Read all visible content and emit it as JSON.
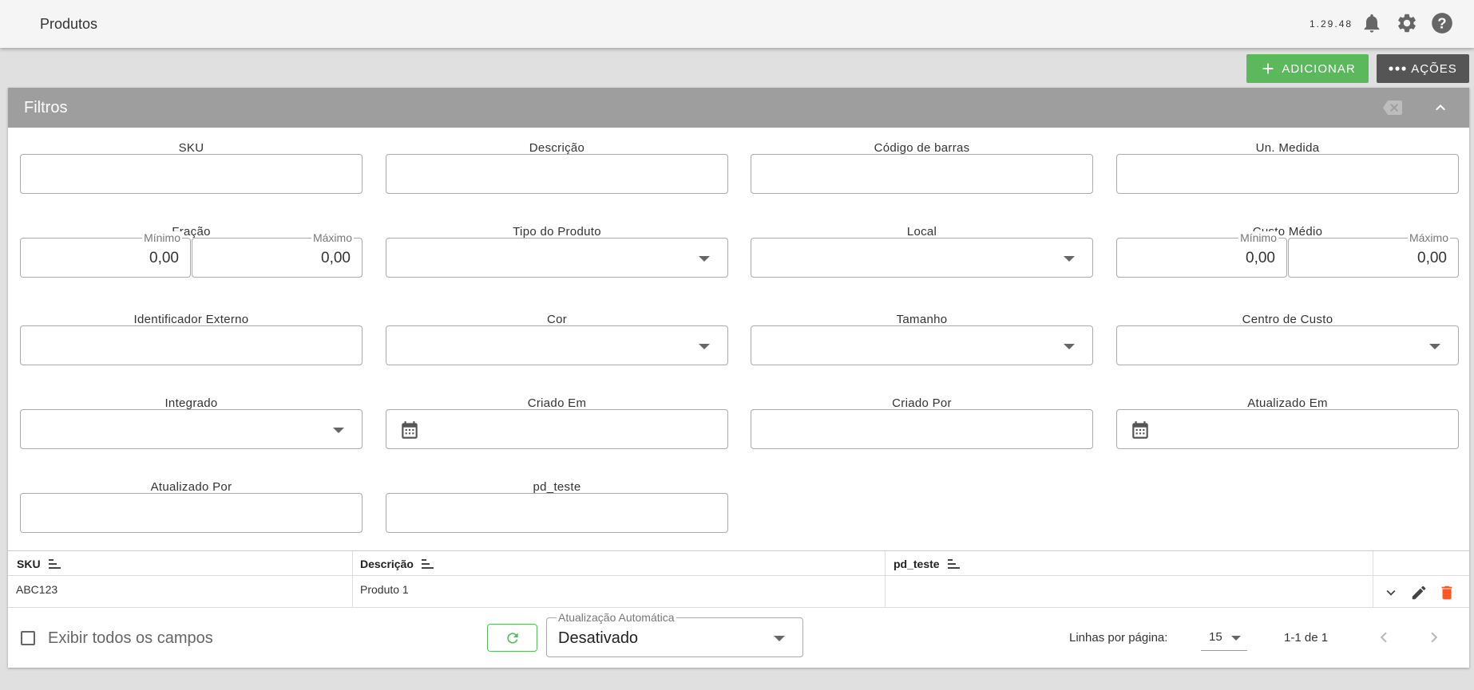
{
  "header": {
    "title": "Produtos",
    "version": "1.29.48"
  },
  "toolbar": {
    "add_label": "ADICIONAR",
    "actions_label": "AÇÕES"
  },
  "filters": {
    "title": "Filtros",
    "sku": {
      "label": "SKU",
      "value": ""
    },
    "descricao": {
      "label": "Descrição",
      "value": ""
    },
    "codigo_barras": {
      "label": "Código de barras",
      "value": ""
    },
    "un_medida": {
      "label": "Un. Medida",
      "value": ""
    },
    "fracao": {
      "label": "Fração",
      "min_label": "Mínimo",
      "min_value": "0,00",
      "max_label": "Máximo",
      "max_value": "0,00"
    },
    "tipo_produto": {
      "label": "Tipo do Produto",
      "value": ""
    },
    "local": {
      "label": "Local",
      "value": ""
    },
    "custo_medio": {
      "label": "Custo Médio",
      "min_label": "Mínimo",
      "min_value": "0,00",
      "max_label": "Máximo",
      "max_value": "0,00"
    },
    "identificador_externo": {
      "label": "Identificador Externo",
      "value": ""
    },
    "cor": {
      "label": "Cor",
      "value": ""
    },
    "tamanho": {
      "label": "Tamanho",
      "value": ""
    },
    "centro_custo": {
      "label": "Centro de Custo",
      "value": ""
    },
    "integrado": {
      "label": "Integrado",
      "value": ""
    },
    "criado_em": {
      "label": "Criado Em",
      "value": ""
    },
    "criado_por": {
      "label": "Criado Por",
      "value": ""
    },
    "atualizado_em": {
      "label": "Atualizado Em",
      "value": ""
    },
    "atualizado_por": {
      "label": "Atualizado Por",
      "value": ""
    },
    "pd_teste": {
      "label": "pd_teste",
      "value": ""
    }
  },
  "table": {
    "columns": [
      "SKU",
      "Descrição",
      "pd_teste"
    ],
    "rows": [
      {
        "sku": "ABC123",
        "descricao": "Produto 1",
        "pd_teste": ""
      }
    ]
  },
  "footer": {
    "show_all_fields_label": "Exibir todos os campos",
    "show_all_fields_checked": false,
    "auto_update_label": "Atualização Automática",
    "auto_update_value": "Desativado",
    "rows_per_page_label": "Linhas por página:",
    "rows_per_page_value": "15",
    "range_text": "1-1 de 1"
  },
  "colors": {
    "accent_green": "#5cb85c",
    "actions_gray": "#555555",
    "filters_header": "#9e9e9e",
    "delete_red": "#ff5722"
  },
  "icons": [
    "bell-icon",
    "gear-icon",
    "help-icon",
    "plus-icon",
    "more-dots-icon",
    "clear-filter-icon",
    "chevron-up-icon",
    "calendar-icon",
    "sort-icon",
    "chevron-down-icon",
    "edit-icon",
    "delete-icon",
    "refresh-icon",
    "chevron-left-icon",
    "chevron-right-icon"
  ]
}
